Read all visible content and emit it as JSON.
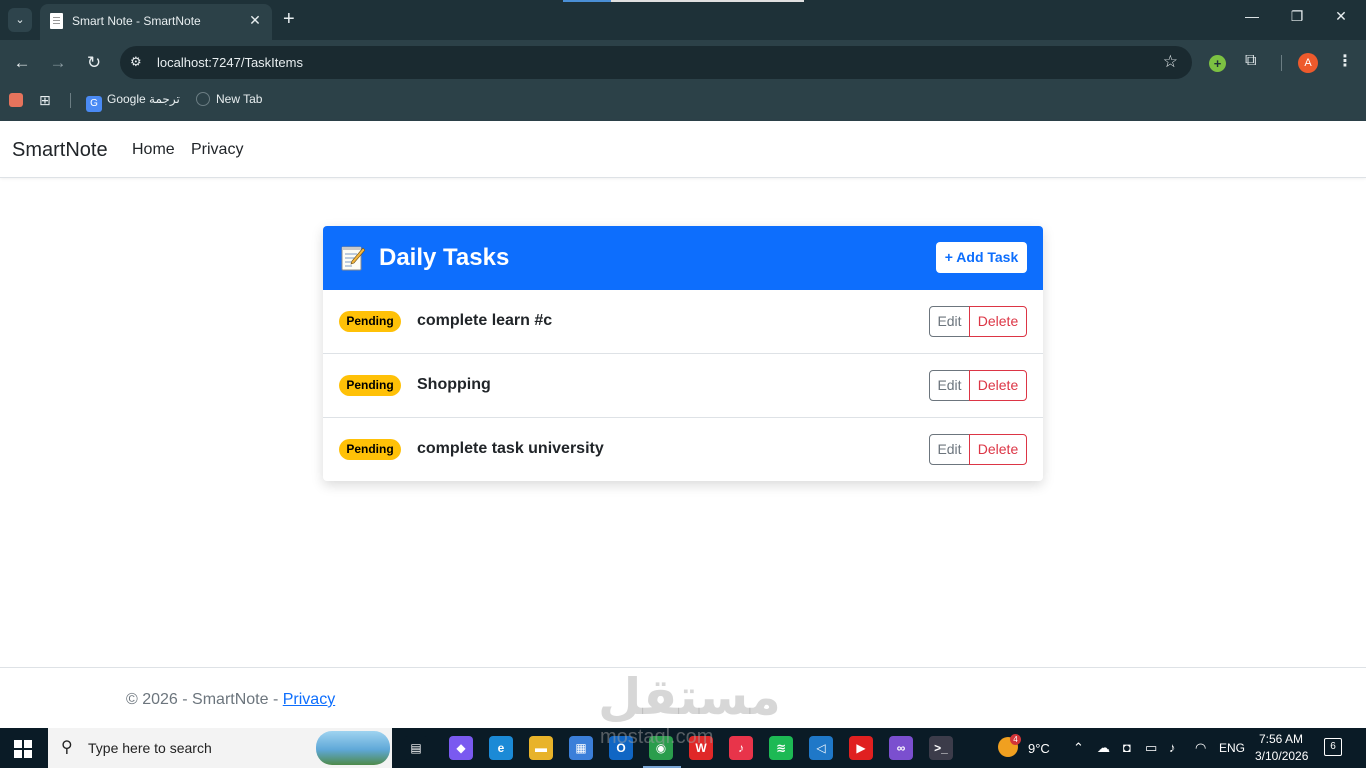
{
  "browser": {
    "tab_title": "Smart Note - SmartNote",
    "tab_close": "✕",
    "new_tab": "+",
    "url": "localhost:7247/TaskItems",
    "bookmarks": [
      {
        "label": "Google ترجمة",
        "icon": "google-translate-icon"
      },
      {
        "label": "New Tab",
        "icon": "globe-icon"
      }
    ],
    "profile_initial": "A",
    "window_controls": {
      "minimize": "—",
      "restore": "❐",
      "close": "✕"
    }
  },
  "site": {
    "brand": "SmartNote",
    "nav": [
      {
        "label": "Home"
      },
      {
        "label": "Privacy"
      }
    ]
  },
  "tasks_card": {
    "icon": "memo-icon",
    "title": "Daily Tasks",
    "add_button": "+ Add Task",
    "header_color": "#0d6efd",
    "tasks": [
      {
        "status": "Pending",
        "title": "complete learn #c",
        "edit": "Edit",
        "delete": "Delete"
      },
      {
        "status": "Pending",
        "title": "Shopping",
        "edit": "Edit",
        "delete": "Delete"
      },
      {
        "status": "Pending",
        "title": "complete task university",
        "edit": "Edit",
        "delete": "Delete"
      }
    ]
  },
  "footer": {
    "text": "© 2026 - SmartNote - ",
    "link": "Privacy"
  },
  "watermark": {
    "text": "مستقل",
    "sub": "mostaql.com"
  },
  "taskbar": {
    "search_placeholder": "Type here to search",
    "weather": "9°C",
    "weather_badge": "4",
    "language": "ENG",
    "time": "7:56 AM",
    "date": "3/10/2026",
    "notifications": "6",
    "apps": [
      {
        "name": "task-view-icon",
        "label": "▤",
        "color": "#0a1b26"
      },
      {
        "name": "copilot-icon",
        "label": "◆",
        "color": "#7a5af0"
      },
      {
        "name": "edge-icon",
        "label": "e",
        "color": "#1b8ad6"
      },
      {
        "name": "file-explorer-icon",
        "label": "▬",
        "color": "#e8b32a"
      },
      {
        "name": "store-icon",
        "label": "▦",
        "color": "#3b7fd9"
      },
      {
        "name": "outlook-icon",
        "label": "O",
        "color": "#1066c4"
      },
      {
        "name": "chrome-icon",
        "label": "◉",
        "color": "#2a9d4c"
      },
      {
        "name": "wps-icon",
        "label": "W",
        "color": "#e02828"
      },
      {
        "name": "music-icon",
        "label": "♪",
        "color": "#e8344a"
      },
      {
        "name": "spotify-icon",
        "label": "≋",
        "color": "#1db954"
      },
      {
        "name": "vscode-icon",
        "label": "◁",
        "color": "#1f78c8"
      },
      {
        "name": "youtube-icon",
        "label": "▶",
        "color": "#e02020"
      },
      {
        "name": "visual-studio-icon",
        "label": "∞",
        "color": "#7b4fcf"
      },
      {
        "name": "terminal-icon",
        "label": ">_",
        "color": "#3c3c4a"
      }
    ]
  }
}
